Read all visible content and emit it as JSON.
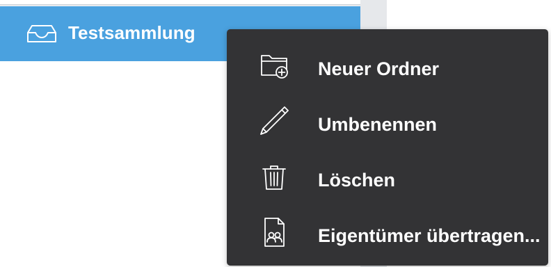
{
  "sidebar": {
    "collection": {
      "label": "Testsammlung",
      "icon": "inbox-tray-icon"
    }
  },
  "context_menu": {
    "items": [
      {
        "label": "Neuer Ordner",
        "icon": "folder-add-icon"
      },
      {
        "label": "Umbenennen",
        "icon": "pencil-icon"
      },
      {
        "label": "Löschen",
        "icon": "trash-icon"
      },
      {
        "label": "Eigentümer übertragen...",
        "icon": "document-users-icon"
      }
    ]
  },
  "colors": {
    "selected_row": "#4aa1df",
    "menu_background": "#333335",
    "menu_text": "#ffffff"
  }
}
